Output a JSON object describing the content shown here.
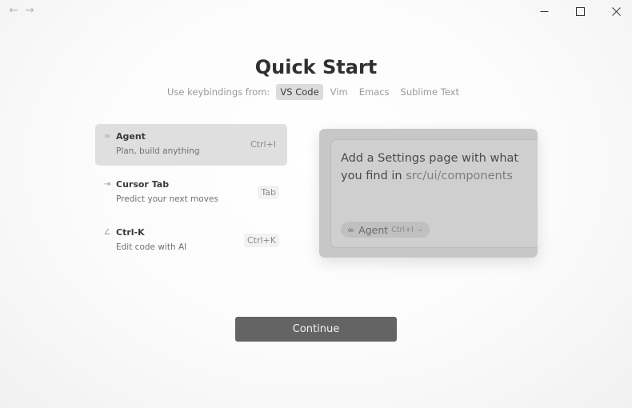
{
  "window": {
    "back_icon": "arrow-left-icon",
    "forward_icon": "arrow-right-icon",
    "minimize_icon": "minimize-icon",
    "maximize_icon": "maximize-icon",
    "close_icon": "close-icon"
  },
  "page": {
    "title": "Quick Start",
    "keybindings_label": "Use keybindings from:",
    "keybinding_options": [
      {
        "label": "VS Code",
        "selected": true
      },
      {
        "label": "Vim",
        "selected": false
      },
      {
        "label": "Emacs",
        "selected": false
      },
      {
        "label": "Sublime Text",
        "selected": false
      }
    ]
  },
  "features": [
    {
      "icon": "infinity-icon",
      "glyph": "∞",
      "title": "Agent",
      "description": "Plan, build anything",
      "shortcut": "Ctrl+I",
      "selected": true
    },
    {
      "icon": "tab-arrow-icon",
      "glyph": "⇥",
      "title": "Cursor Tab",
      "description": "Predict your next moves",
      "shortcut": "Tab",
      "selected": false
    },
    {
      "icon": "pencil-icon",
      "glyph": "∠",
      "title": "Ctrl-K",
      "description": "Edit code with AI",
      "shortcut": "Ctrl+K",
      "selected": false
    }
  ],
  "demo": {
    "prompt_text": "Add a Settings page with what you find in",
    "prompt_path": "src/ui/components",
    "mode_icon": "infinity-icon",
    "mode_label": "Agent",
    "mode_shortcut": "Ctrl+I",
    "mode_chevron": "chevron-down-icon"
  },
  "continue_label": "Continue",
  "colors": {
    "selected_bg": "#dfdfdf",
    "button_bg": "#646464",
    "panel_bg": "#c7c7c7"
  }
}
